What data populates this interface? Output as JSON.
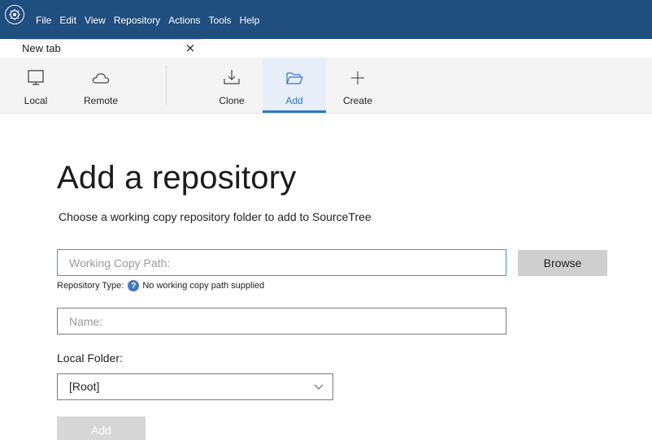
{
  "menu": [
    "File",
    "Edit",
    "View",
    "Repository",
    "Actions",
    "Tools",
    "Help"
  ],
  "tab": {
    "label": "New tab",
    "close_glyph": "×",
    "new_glyph": "+"
  },
  "toolbar": {
    "local": "Local",
    "remote": "Remote",
    "clone": "Clone",
    "add": "Add",
    "create": "Create",
    "active": "add"
  },
  "main": {
    "title": "Add a repository",
    "subtitle": "Choose a working copy repository folder to add to SourceTree",
    "path_placeholder": "Working Copy Path:",
    "path_value": "",
    "browse_label": "Browse",
    "repo_type_label": "Repository Type:",
    "repo_type_help_glyph": "?",
    "repo_type_status": "No working copy path supplied",
    "name_placeholder": "Name:",
    "name_value": "",
    "local_folder_label": "Local Folder:",
    "local_folder_value": "[Root]",
    "add_label": "Add"
  },
  "colors": {
    "titlebar": "#1f4e7f",
    "accent": "#2f77c9",
    "toolbar_bg": "#f4f4f4"
  },
  "icons": {
    "app": "sourcetree-logo-icon",
    "local": "monitor-icon",
    "remote": "cloud-icon",
    "clone": "download-icon",
    "add": "folder-open-icon",
    "create": "plus-icon",
    "help": "help-icon",
    "dropdown": "chevron-down-icon"
  }
}
